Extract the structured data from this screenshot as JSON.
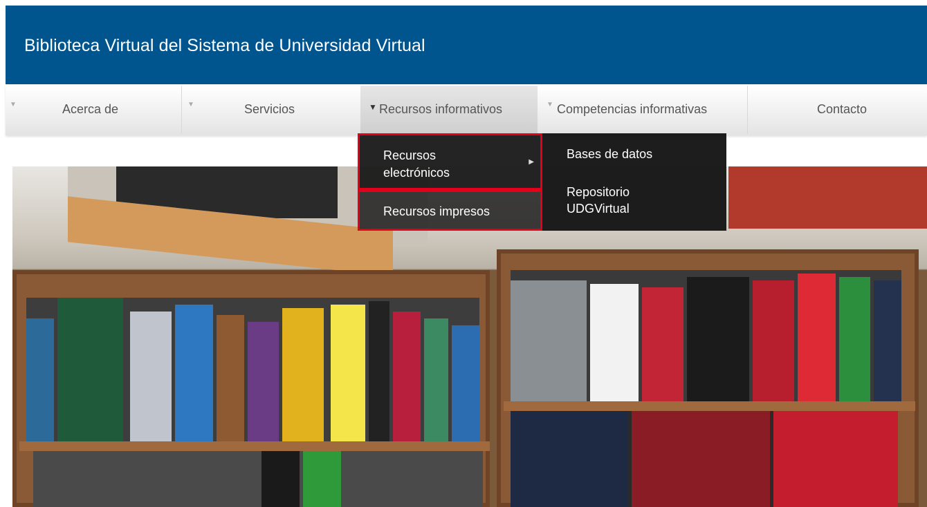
{
  "header": {
    "title": "Biblioteca Virtual del Sistema de Universidad Virtual",
    "bg_color": "#00558f"
  },
  "nav": {
    "items": [
      {
        "label": "Acerca de",
        "has_submenu": true
      },
      {
        "label": "Servicios",
        "has_submenu": true
      },
      {
        "label": "Recursos informativos",
        "has_submenu": true,
        "active": true
      },
      {
        "label": "Competencias informativas",
        "has_submenu": true
      },
      {
        "label": "Contacto",
        "has_submenu": false
      }
    ],
    "arrow_icon": "▼"
  },
  "dropdown": {
    "items": [
      {
        "label": "Recursos electrónicos",
        "has_submenu": true,
        "caret": "▶"
      },
      {
        "label": "Recursos impresos",
        "has_submenu": false
      }
    ],
    "submenu": [
      {
        "label": "Bases de datos"
      },
      {
        "label": "Repositorio UDGVirtual"
      }
    ],
    "highlight_color": "#e2001a"
  },
  "hero": {
    "description_icon": "bookshelf-photo"
  }
}
